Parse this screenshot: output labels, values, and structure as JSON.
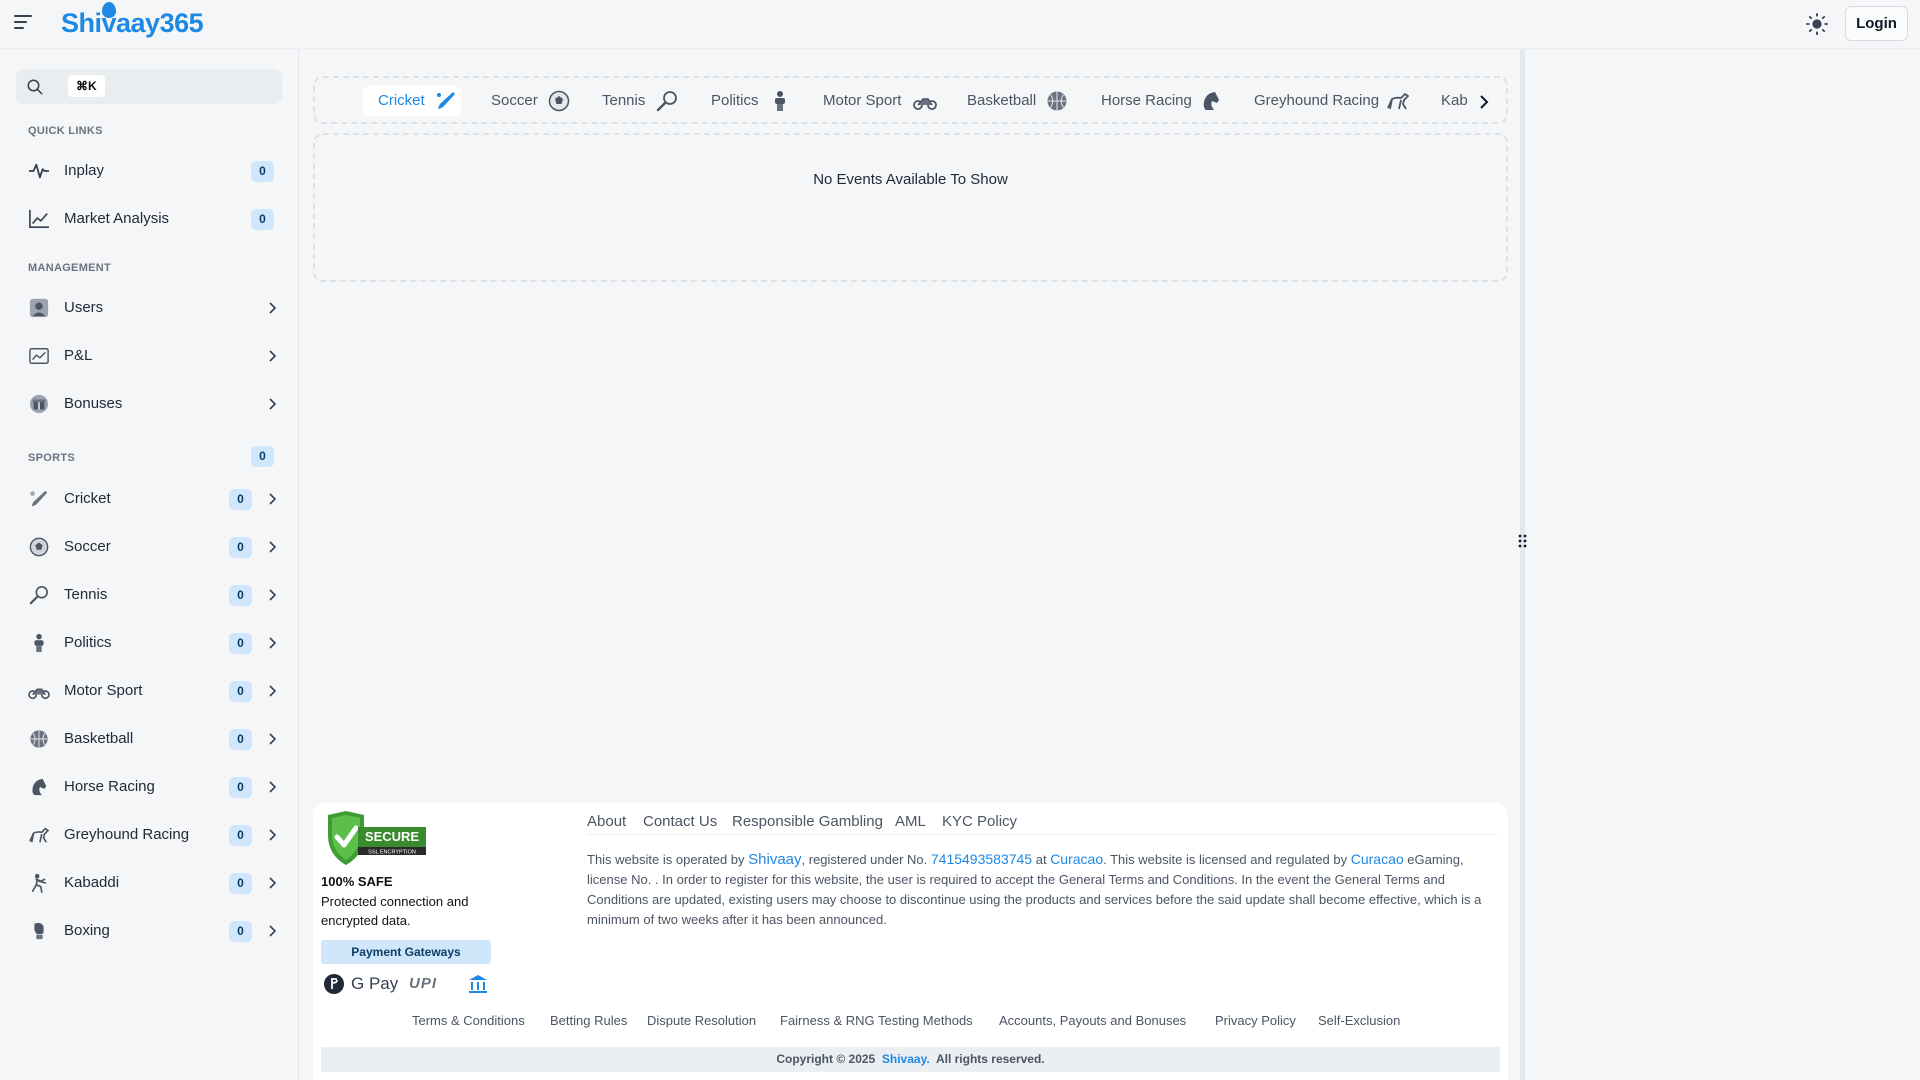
{
  "header": {
    "logo_text": "Shivaay365",
    "login_label": "Login"
  },
  "sidebar": {
    "search_shortcut": "⌘K",
    "quick_links_title": "QUICK LINKS",
    "quick_links": [
      {
        "label": "Inplay",
        "count": "0",
        "icon": "pulse-icon"
      },
      {
        "label": "Market Analysis",
        "count": "0",
        "icon": "line-chart-icon"
      }
    ],
    "management_title": "MANAGEMENT",
    "management": [
      {
        "label": "Users",
        "icon": "user-icon"
      },
      {
        "label": "P&L",
        "icon": "pnl-icon"
      },
      {
        "label": "Bonuses",
        "icon": "gift-icon"
      }
    ],
    "sports_title": "SPORTS",
    "sports_count": "0",
    "sports": [
      {
        "label": "Cricket",
        "count": "0",
        "icon": "cricket-bat-icon"
      },
      {
        "label": "Soccer",
        "count": "0",
        "icon": "soccer-ball-icon"
      },
      {
        "label": "Tennis",
        "count": "0",
        "icon": "tennis-racket-icon"
      },
      {
        "label": "Politics",
        "count": "0",
        "icon": "politics-icon"
      },
      {
        "label": "Motor Sport",
        "count": "0",
        "icon": "motorbike-icon"
      },
      {
        "label": "Basketball",
        "count": "0",
        "icon": "basketball-icon"
      },
      {
        "label": "Horse Racing",
        "count": "0",
        "icon": "horse-icon"
      },
      {
        "label": "Greyhound Racing",
        "count": "0",
        "icon": "greyhound-icon"
      },
      {
        "label": "Kabaddi",
        "count": "0",
        "icon": "kabaddi-icon"
      },
      {
        "label": "Boxing",
        "count": "0",
        "icon": "boxing-glove-icon"
      }
    ]
  },
  "tabs": [
    {
      "label": "Cricket",
      "icon": "cricket-bat-icon",
      "active": true
    },
    {
      "label": "Soccer",
      "icon": "soccer-ball-icon"
    },
    {
      "label": "Tennis",
      "icon": "tennis-racket-icon"
    },
    {
      "label": "Politics",
      "icon": "politics-icon"
    },
    {
      "label": "Motor Sport",
      "icon": "motorbike-icon"
    },
    {
      "label": "Basketball",
      "icon": "basketball-icon"
    },
    {
      "label": "Horse Racing",
      "icon": "horse-icon"
    },
    {
      "label": "Greyhound Racing",
      "icon": "greyhound-icon"
    },
    {
      "label": "Kab",
      "icon": ""
    }
  ],
  "events": {
    "empty_message": "No Events Available To Show"
  },
  "footer": {
    "secure_badge_text": "SECURE",
    "secure_badge_sub": "SSL ENCRYPTION",
    "safe_title": "100% SAFE",
    "safe_desc": "Protected connection and encrypted data.",
    "payment_gateways_label": "Payment Gateways",
    "payment_methods": [
      "phonepe-icon",
      "google-pay-icon",
      "upi-icon",
      "bank-icon"
    ],
    "gpay_text": "G Pay",
    "upi_text": "UPI",
    "links": [
      "About",
      "Contact Us",
      "Responsible Gambling",
      "AML",
      "KYC Policy"
    ],
    "legal": {
      "part1": "This website is operated by ",
      "operator": "Shivaay",
      "part2": ", registered under No. ",
      "reg_no": "7415493583745",
      "part3": " at ",
      "place": "Curacao",
      "part4": ". This website is licensed and regulated by ",
      "regulator": "Curacao",
      "part5": " eGaming, license No. . In order to register for this website, the user is required to accept the General Terms and Conditions. In the event the General Terms and Conditions are updated, existing users may choose to discontinue using the products and services before the said update shall become effective, which is a minimum of two weeks after it has been announced."
    },
    "bottom_links": [
      "Terms & Conditions",
      "Betting Rules",
      "Dispute Resolution",
      "Fairness & RNG Testing Methods",
      "Accounts, Payouts and Bonuses",
      "Privacy Policy",
      "Self-Exclusion"
    ],
    "copyright_prefix": "Copyright © 2025",
    "copyright_brand": "Shivaay.",
    "copyright_suffix": "All rights reserved."
  },
  "colors": {
    "accent": "#1e88e5",
    "badge_bg": "#cfe6fb",
    "background": "#f4f6f8"
  }
}
